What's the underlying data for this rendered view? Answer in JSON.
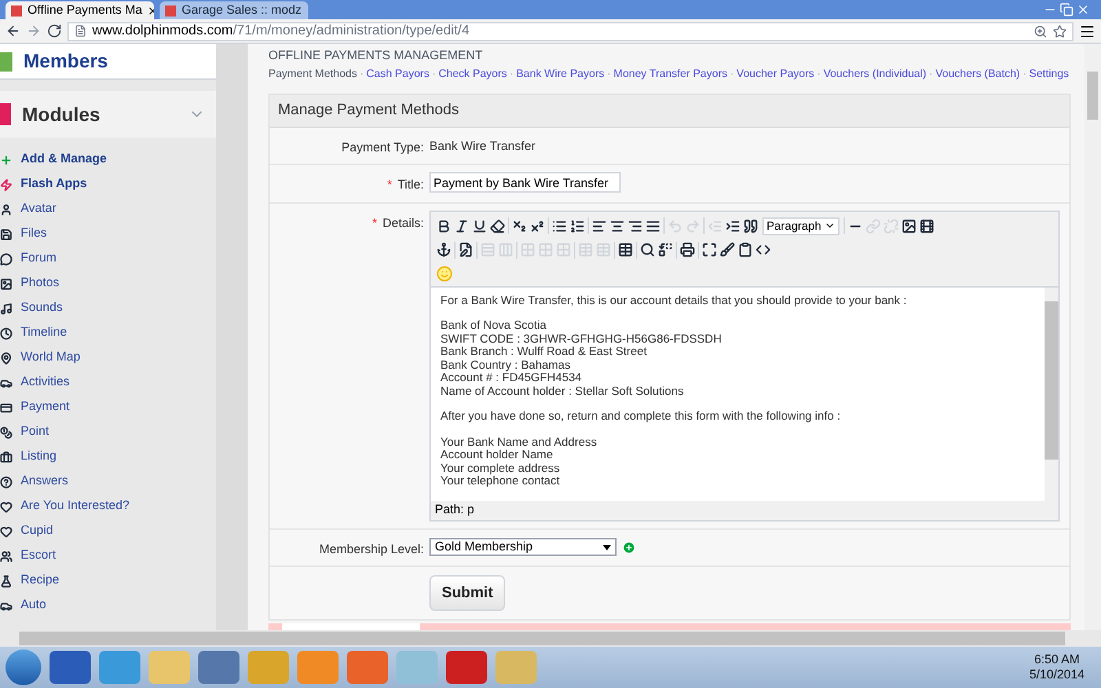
{
  "browser": {
    "tabs": [
      {
        "title": "Offline Payments Ma",
        "selected": true
      },
      {
        "title": "Garage Sales :: modz",
        "selected": false
      }
    ],
    "url_host": "www.dolphinmods.com",
    "url_path": "/71/m/money/administration/type/edit/4"
  },
  "sidebar": {
    "members_title": "Members",
    "modules_title": "Modules",
    "items": [
      {
        "label": "Add & Manage",
        "kind": "group"
      },
      {
        "label": "Flash Apps",
        "kind": "group"
      },
      {
        "label": "Avatar",
        "kind": "module"
      },
      {
        "label": "Files",
        "kind": "module"
      },
      {
        "label": "Forum",
        "kind": "module"
      },
      {
        "label": "Photos",
        "kind": "module"
      },
      {
        "label": "Sounds",
        "kind": "module"
      },
      {
        "label": "Timeline",
        "kind": "module"
      },
      {
        "label": "World Map",
        "kind": "module"
      },
      {
        "label": "Activities",
        "kind": "module"
      },
      {
        "label": "Payment",
        "kind": "module"
      },
      {
        "label": "Point",
        "kind": "module"
      },
      {
        "label": "Listing",
        "kind": "module"
      },
      {
        "label": "Answers",
        "kind": "module"
      },
      {
        "label": "Are You Interested?",
        "kind": "module"
      },
      {
        "label": "Cupid",
        "kind": "module"
      },
      {
        "label": "Escort",
        "kind": "module"
      },
      {
        "label": "Recipe",
        "kind": "module"
      },
      {
        "label": "Auto",
        "kind": "module"
      }
    ]
  },
  "page": {
    "section_title": "OFFLINE PAYMENTS MANAGEMENT",
    "separator": "·",
    "nav": [
      {
        "label": "Payment Methods",
        "selected": true
      },
      {
        "label": "Cash Payors",
        "selected": false
      },
      {
        "label": "Check Payors",
        "selected": false
      },
      {
        "label": "Bank Wire Payors",
        "selected": false
      },
      {
        "label": "Money Transfer Payors",
        "selected": false
      },
      {
        "label": "Voucher Payors",
        "selected": false
      },
      {
        "label": "Vouchers (Individual)",
        "selected": false
      },
      {
        "label": "Vouchers (Batch)",
        "selected": false
      },
      {
        "label": "Settings",
        "selected": false
      }
    ]
  },
  "form": {
    "title": "Manage Payment Methods",
    "required_mark": "*",
    "payment_type": {
      "label": "Payment Type:",
      "value": "Bank Wire Transfer"
    },
    "title_field": {
      "label": "Title:",
      "required": true,
      "value": "Payment by Bank Wire Transfer"
    },
    "details": {
      "label": "Details:",
      "required": true,
      "format": "Paragraph",
      "paragraphs": [
        [
          "For a Bank Wire Transfer, this is our account details that you should provide to your bank :"
        ],
        [
          "Bank of Nova Scotia",
          "SWIFT CODE : 3GHWR-GFHGHG-H56G86-FDSSDH",
          "Bank Branch : Wulff Road & East Street",
          "Bank Country : Bahamas",
          "Account # : FD45GFH4534",
          "Name of Account holder : Stellar Soft Solutions"
        ],
        [
          "After you have done so, return and complete this form with the following info :"
        ],
        [
          "Your Bank Name and Address",
          "Account holder Name",
          "Your complete address",
          "Your telephone contact"
        ]
      ],
      "path": "Path: p"
    },
    "membership": {
      "label": "Membership Level:",
      "required": false,
      "value": "Gold Membership"
    },
    "submit": "Submit"
  },
  "taskbar": {
    "time": "6:50 AM",
    "date": "5/10/2014"
  }
}
